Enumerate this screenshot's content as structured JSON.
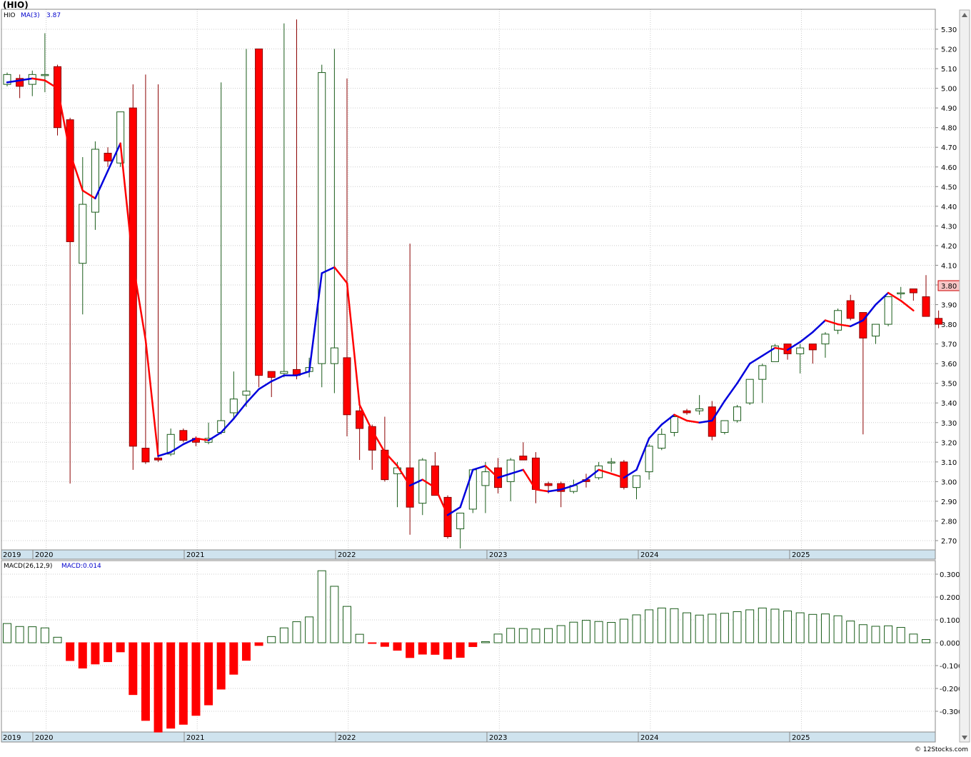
{
  "header": {
    "ticker": "(HIO)"
  },
  "main_panel": {
    "legend_symbol": "HIO",
    "ma_label": "MA(3)",
    "ma_value": "3.87",
    "last_price_label": "3.80"
  },
  "macd_panel": {
    "label": "MACD(26,12,9)",
    "value_label": "MACD:0.014"
  },
  "footer": {
    "watermark": "© 12Stocks.com"
  },
  "colors": {
    "up": "#ffffff",
    "up_border": "#1a5c1a",
    "down": "#ff0000",
    "down_border": "#8b0000",
    "ma_up": "#0000dd",
    "ma_down": "#ff0000",
    "axis_band": "#cfe3ee",
    "grid": "#cccccc"
  },
  "chart_data": [
    {
      "type": "candlestick",
      "title": "(HIO)",
      "y_ticks": [
        "2.70",
        "2.80",
        "2.90",
        "3.00",
        "3.10",
        "3.20",
        "3.30",
        "3.40",
        "3.50",
        "3.60",
        "3.70",
        "3.80",
        "3.90",
        "4.00",
        "4.10",
        "4.20",
        "4.30",
        "4.40",
        "4.50",
        "4.60",
        "4.70",
        "4.80",
        "4.90",
        "5.00",
        "5.10",
        "5.20",
        "5.30"
      ],
      "ylim": [
        2.65,
        5.35
      ],
      "x_labels": [
        "2019",
        "2020",
        "2021",
        "2022",
        "2023",
        "2024",
        "2025"
      ],
      "candles": [
        {
          "date": "2019-11",
          "o": 5.02,
          "h": 5.08,
          "l": 5.01,
          "c": 5.07
        },
        {
          "date": "2019-12",
          "o": 5.05,
          "h": 5.07,
          "l": 4.95,
          "c": 5.01
        },
        {
          "date": "2020-01",
          "o": 5.02,
          "h": 5.09,
          "l": 4.96,
          "c": 5.07
        },
        {
          "date": "2020-02",
          "o": 5.07,
          "h": 5.28,
          "l": 4.98,
          "c": 5.07
        },
        {
          "date": "2020-03",
          "o": 5.11,
          "h": 5.12,
          "l": 4.76,
          "c": 4.8
        },
        {
          "date": "2020-04",
          "o": 4.84,
          "h": 4.85,
          "l": 2.99,
          "c": 4.22
        },
        {
          "date": "2020-05",
          "o": 4.11,
          "h": 4.65,
          "l": 3.85,
          "c": 4.41
        },
        {
          "date": "2020-06",
          "o": 4.37,
          "h": 4.73,
          "l": 4.28,
          "c": 4.69
        },
        {
          "date": "2020-07",
          "o": 4.67,
          "h": 4.7,
          "l": 4.6,
          "c": 4.63
        },
        {
          "date": "2020-08",
          "o": 4.62,
          "h": 4.88,
          "l": 4.6,
          "c": 4.88
        },
        {
          "date": "2020-09",
          "o": 4.9,
          "h": 5.02,
          "l": 3.06,
          "c": 3.18
        },
        {
          "date": "2020-10",
          "o": 3.17,
          "h": 5.07,
          "l": 3.09,
          "c": 3.1
        },
        {
          "date": "2020-11",
          "o": 3.12,
          "h": 5.02,
          "l": 3.1,
          "c": 3.11
        },
        {
          "date": "2020-12",
          "o": 3.14,
          "h": 3.27,
          "l": 3.13,
          "c": 3.24
        },
        {
          "date": "2021-01",
          "o": 3.26,
          "h": 3.27,
          "l": 3.2,
          "c": 3.21
        },
        {
          "date": "2021-02",
          "o": 3.22,
          "h": 3.23,
          "l": 3.18,
          "c": 3.2
        },
        {
          "date": "2021-03",
          "o": 3.2,
          "h": 3.3,
          "l": 3.19,
          "c": 3.22
        },
        {
          "date": "2021-04",
          "o": 3.25,
          "h": 5.03,
          "l": 3.24,
          "c": 3.31
        },
        {
          "date": "2021-05",
          "o": 3.35,
          "h": 3.56,
          "l": 3.32,
          "c": 3.42
        },
        {
          "date": "2021-06",
          "o": 3.44,
          "h": 5.2,
          "l": 3.38,
          "c": 3.46
        },
        {
          "date": "2021-07",
          "o": 5.2,
          "h": 5.2,
          "l": 3.48,
          "c": 3.54
        },
        {
          "date": "2021-08",
          "o": 3.56,
          "h": 3.56,
          "l": 3.43,
          "c": 3.53
        },
        {
          "date": "2021-09",
          "o": 3.55,
          "h": 5.33,
          "l": 3.53,
          "c": 3.56
        },
        {
          "date": "2021-10",
          "o": 3.57,
          "h": 5.35,
          "l": 3.52,
          "c": 3.54
        },
        {
          "date": "2021-11",
          "o": 3.56,
          "h": 3.63,
          "l": 3.53,
          "c": 3.58
        },
        {
          "date": "2021-12",
          "o": 3.6,
          "h": 5.12,
          "l": 3.48,
          "c": 5.08
        },
        {
          "date": "2022-01",
          "o": 3.6,
          "h": 5.2,
          "l": 3.45,
          "c": 3.68
        },
        {
          "date": "2022-02",
          "o": 3.63,
          "h": 5.05,
          "l": 3.23,
          "c": 3.34
        },
        {
          "date": "2022-03",
          "o": 3.36,
          "h": 3.41,
          "l": 3.11,
          "c": 3.27
        },
        {
          "date": "2022-04",
          "o": 3.28,
          "h": 3.29,
          "l": 3.06,
          "c": 3.16
        },
        {
          "date": "2022-05",
          "o": 3.16,
          "h": 3.33,
          "l": 3.0,
          "c": 3.01
        },
        {
          "date": "2022-06",
          "o": 3.04,
          "h": 3.1,
          "l": 2.87,
          "c": 3.07
        },
        {
          "date": "2022-07",
          "o": 3.07,
          "h": 4.21,
          "l": 2.73,
          "c": 2.87
        },
        {
          "date": "2022-08",
          "o": 2.89,
          "h": 3.12,
          "l": 2.83,
          "c": 3.11
        },
        {
          "date": "2022-09",
          "o": 3.08,
          "h": 3.15,
          "l": 2.93,
          "c": 2.93
        },
        {
          "date": "2022-10",
          "o": 2.92,
          "h": 2.93,
          "l": 2.71,
          "c": 2.72
        },
        {
          "date": "2022-11",
          "o": 2.76,
          "h": 2.83,
          "l": 2.66,
          "c": 2.84
        },
        {
          "date": "2022-12",
          "o": 2.86,
          "h": 3.06,
          "l": 2.84,
          "c": 3.06
        },
        {
          "date": "2023-01",
          "o": 2.98,
          "h": 3.1,
          "l": 2.84,
          "c": 3.05
        },
        {
          "date": "2023-02",
          "o": 3.07,
          "h": 3.12,
          "l": 2.94,
          "c": 2.97
        },
        {
          "date": "2023-03",
          "o": 3.0,
          "h": 3.12,
          "l": 2.9,
          "c": 3.11
        },
        {
          "date": "2023-04",
          "o": 3.13,
          "h": 3.2,
          "l": 3.11,
          "c": 3.11
        },
        {
          "date": "2023-05",
          "o": 3.12,
          "h": 3.15,
          "l": 2.89,
          "c": 2.96
        },
        {
          "date": "2023-06",
          "o": 2.99,
          "h": 3.0,
          "l": 2.94,
          "c": 2.98
        },
        {
          "date": "2023-07",
          "o": 2.99,
          "h": 3.0,
          "l": 2.87,
          "c": 2.95
        },
        {
          "date": "2023-08",
          "o": 2.95,
          "h": 3.01,
          "l": 2.94,
          "c": 2.98
        },
        {
          "date": "2023-09",
          "o": 3.01,
          "h": 3.04,
          "l": 2.97,
          "c": 3.0
        },
        {
          "date": "2023-10",
          "o": 3.02,
          "h": 3.1,
          "l": 3.01,
          "c": 3.08
        },
        {
          "date": "2023-11",
          "o": 3.1,
          "h": 3.12,
          "l": 3.05,
          "c": 3.1
        },
        {
          "date": "2023-12",
          "o": 3.1,
          "h": 3.11,
          "l": 2.96,
          "c": 2.97
        },
        {
          "date": "2024-01",
          "o": 2.97,
          "h": 3.03,
          "l": 2.91,
          "c": 3.03
        },
        {
          "date": "2024-02",
          "o": 3.05,
          "h": 3.19,
          "l": 3.01,
          "c": 3.18
        },
        {
          "date": "2024-03",
          "o": 3.17,
          "h": 3.27,
          "l": 3.16,
          "c": 3.24
        },
        {
          "date": "2024-04",
          "o": 3.25,
          "h": 3.34,
          "l": 3.23,
          "c": 3.33
        },
        {
          "date": "2024-05",
          "o": 3.36,
          "h": 3.37,
          "l": 3.34,
          "c": 3.35
        },
        {
          "date": "2024-06",
          "o": 3.36,
          "h": 3.44,
          "l": 3.34,
          "c": 3.37
        },
        {
          "date": "2024-07",
          "o": 3.38,
          "h": 3.41,
          "l": 3.21,
          "c": 3.23
        },
        {
          "date": "2024-08",
          "o": 3.25,
          "h": 3.31,
          "l": 3.24,
          "c": 3.31
        },
        {
          "date": "2024-09",
          "o": 3.31,
          "h": 3.39,
          "l": 3.3,
          "c": 3.38
        },
        {
          "date": "2024-10",
          "o": 3.4,
          "h": 3.52,
          "l": 3.39,
          "c": 3.52
        },
        {
          "date": "2024-11",
          "o": 3.52,
          "h": 3.6,
          "l": 3.4,
          "c": 3.59
        },
        {
          "date": "2024-12",
          "o": 3.61,
          "h": 3.7,
          "l": 3.61,
          "c": 3.69
        },
        {
          "date": "2025-01",
          "o": 3.7,
          "h": 3.7,
          "l": 3.62,
          "c": 3.65
        },
        {
          "date": "2025-02",
          "o": 3.65,
          "h": 3.7,
          "l": 3.55,
          "c": 3.68
        },
        {
          "date": "2025-03",
          "o": 3.7,
          "h": 3.7,
          "l": 3.6,
          "c": 3.67
        },
        {
          "date": "2025-04",
          "o": 3.7,
          "h": 3.76,
          "l": 3.63,
          "c": 3.75
        },
        {
          "date": "2025-05",
          "o": 3.77,
          "h": 3.88,
          "l": 3.75,
          "c": 3.87
        },
        {
          "date": "2025-06",
          "o": 3.92,
          "h": 3.95,
          "l": 3.82,
          "c": 3.83
        },
        {
          "date": "2025-07",
          "o": 3.86,
          "h": 3.86,
          "l": 3.24,
          "c": 3.73
        },
        {
          "date": "2025-08",
          "o": 3.74,
          "h": 3.8,
          "l": 3.7,
          "c": 3.8
        },
        {
          "date": "2025-09",
          "o": 3.8,
          "h": 3.94,
          "l": 3.79,
          "c": 3.94
        },
        {
          "date": "2025-10",
          "o": 3.96,
          "h": 3.99,
          "l": 3.93,
          "c": 3.96
        },
        {
          "date": "2025-11",
          "o": 3.98,
          "h": 3.98,
          "l": 3.92,
          "c": 3.96
        },
        {
          "date": "2025-12",
          "o": 3.94,
          "h": 4.05,
          "l": 3.84,
          "c": 3.84
        },
        {
          "date": "2026-01",
          "o": 3.83,
          "h": 3.87,
          "l": 3.78,
          "c": 3.8
        }
      ],
      "ma3": [
        5.03,
        5.04,
        5.05,
        5.04,
        5.0,
        4.67,
        4.48,
        4.44,
        4.58,
        4.72,
        4.11,
        3.72,
        3.13,
        3.15,
        3.19,
        3.22,
        3.21,
        3.25,
        3.32,
        3.4,
        3.47,
        3.51,
        3.54,
        3.54,
        3.56,
        4.06,
        4.09,
        4.01,
        3.39,
        3.26,
        3.15,
        3.08,
        2.98,
        3.01,
        2.97,
        2.83,
        2.87,
        3.06,
        3.08,
        3.02,
        3.04,
        3.06,
        2.96,
        2.95,
        2.96,
        2.98,
        3.01,
        3.06,
        3.04,
        3.02,
        3.06,
        3.22,
        3.29,
        3.34,
        3.31,
        3.3,
        3.31,
        3.41,
        3.5,
        3.6,
        3.64,
        3.68,
        3.67,
        3.71,
        3.76,
        3.82,
        3.8,
        3.79,
        3.82,
        3.9,
        3.96,
        3.92,
        3.87
      ]
    },
    {
      "type": "bar",
      "title": "MACD(26,12,9)",
      "y_ticks": [
        "-0.300",
        "-0.200",
        "-0.100",
        "0.000",
        "0.100",
        "0.200",
        "0.300"
      ],
      "ylim": [
        -0.39,
        0.33
      ],
      "values": [
        0.084,
        0.071,
        0.07,
        0.065,
        0.024,
        -0.078,
        -0.111,
        -0.093,
        -0.083,
        -0.04,
        -0.227,
        -0.34,
        -0.391,
        -0.374,
        -0.357,
        -0.318,
        -0.272,
        -0.203,
        -0.138,
        -0.077,
        -0.012,
        0.027,
        0.065,
        0.092,
        0.113,
        0.315,
        0.247,
        0.159,
        0.037,
        -0.002,
        -0.016,
        -0.033,
        -0.065,
        -0.05,
        -0.051,
        -0.071,
        -0.064,
        -0.017,
        0.005,
        0.038,
        0.063,
        0.062,
        0.06,
        0.062,
        0.075,
        0.09,
        0.098,
        0.093,
        0.089,
        0.103,
        0.122,
        0.144,
        0.152,
        0.149,
        0.131,
        0.121,
        0.125,
        0.129,
        0.136,
        0.144,
        0.152,
        0.147,
        0.139,
        0.131,
        0.124,
        0.126,
        0.118,
        0.095,
        0.079,
        0.072,
        0.074,
        0.067,
        0.038,
        0.014
      ]
    }
  ]
}
